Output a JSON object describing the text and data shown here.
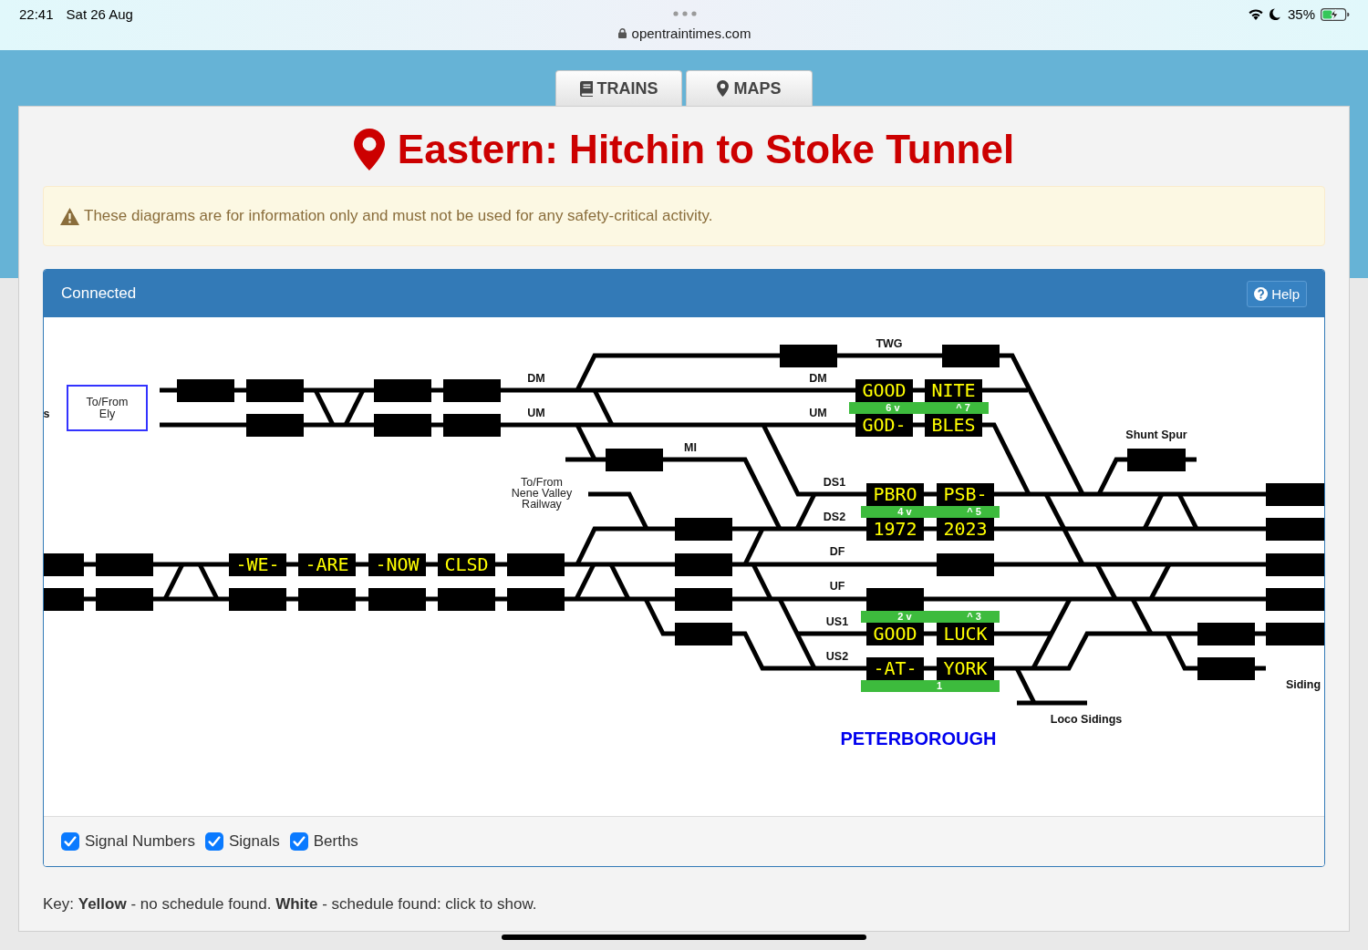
{
  "status_bar": {
    "time": "22:41",
    "date": "Sat 26 Aug",
    "url": "opentraintimes.com",
    "battery": "35%"
  },
  "tabs": [
    {
      "label": "TRAINS"
    },
    {
      "label": "MAPS"
    }
  ],
  "title": "Eastern: Hitchin to Stoke Tunnel",
  "alert": "These diagrams are for information only and must not be used for any safety-critical activity.",
  "panel": {
    "heading": "Connected",
    "help_button": "Help",
    "diagram": {
      "link": "To/From Ely",
      "note": "To/From Nene Valley Railway",
      "track_labels": [
        "TWG",
        "DM",
        "DM",
        "s",
        "UM",
        "UM",
        "Shunt Spur",
        "MI",
        "DS1",
        "DS2",
        "DF",
        "UF",
        "US1",
        "US2",
        "Siding",
        "Loco Sidings"
      ],
      "berths": [
        {
          "text": "GOOD",
          "scheduled": false
        },
        {
          "text": "NITE",
          "scheduled": false
        },
        {
          "text": "GOD-",
          "scheduled": false
        },
        {
          "text": "BLES",
          "scheduled": false
        },
        {
          "text": "PBRO",
          "scheduled": false
        },
        {
          "text": "PSB-",
          "scheduled": false
        },
        {
          "text": "1972",
          "scheduled": false
        },
        {
          "text": "2023",
          "scheduled": false
        },
        {
          "text": "-WE-",
          "scheduled": false
        },
        {
          "text": "-ARE",
          "scheduled": false
        },
        {
          "text": "-NOW",
          "scheduled": false
        },
        {
          "text": "CLSD",
          "scheduled": false
        },
        {
          "text": "GOOD",
          "scheduled": false
        },
        {
          "text": "LUCK",
          "scheduled": false
        },
        {
          "text": "-AT-",
          "scheduled": false
        },
        {
          "text": "YORK",
          "scheduled": false
        }
      ],
      "signal_bars": [
        {
          "numbers": [
            "6 v",
            "^ 7"
          ]
        },
        {
          "numbers": [
            "4 v",
            "^ 5"
          ]
        },
        {
          "numbers": [
            "2 v",
            "^ 3"
          ]
        },
        {
          "numbers": [
            "1"
          ]
        }
      ],
      "station": "PETERBOROUGH"
    },
    "options": [
      {
        "label": "Signal Numbers",
        "checked": true
      },
      {
        "label": "Signals",
        "checked": true
      },
      {
        "label": "Berths",
        "checked": true
      }
    ]
  },
  "key": "Key: **Yellow** - no schedule found. **White** - schedule found: click to show."
}
